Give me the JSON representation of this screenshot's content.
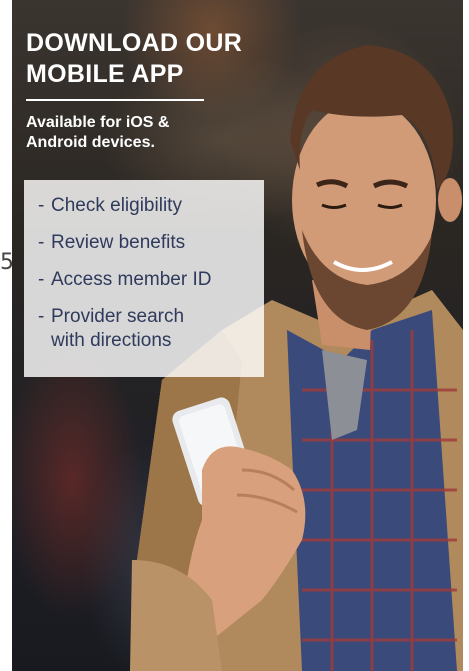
{
  "edge_text": "5",
  "banner": {
    "headline": "DOWNLOAD OUR MOBILE APP",
    "subtitle": "Available for iOS & Android devices.",
    "features": [
      {
        "dash": "-",
        "text": "Check eligibility"
      },
      {
        "dash": "-",
        "text": "Review benefits"
      },
      {
        "dash": "-",
        "text": "Access member ID"
      },
      {
        "dash": "-",
        "text": "Provider search\nwith directions"
      }
    ]
  },
  "colors": {
    "feature_text": "#2f3a5c",
    "feature_box": "#ffffff",
    "headline": "#ffffff"
  }
}
